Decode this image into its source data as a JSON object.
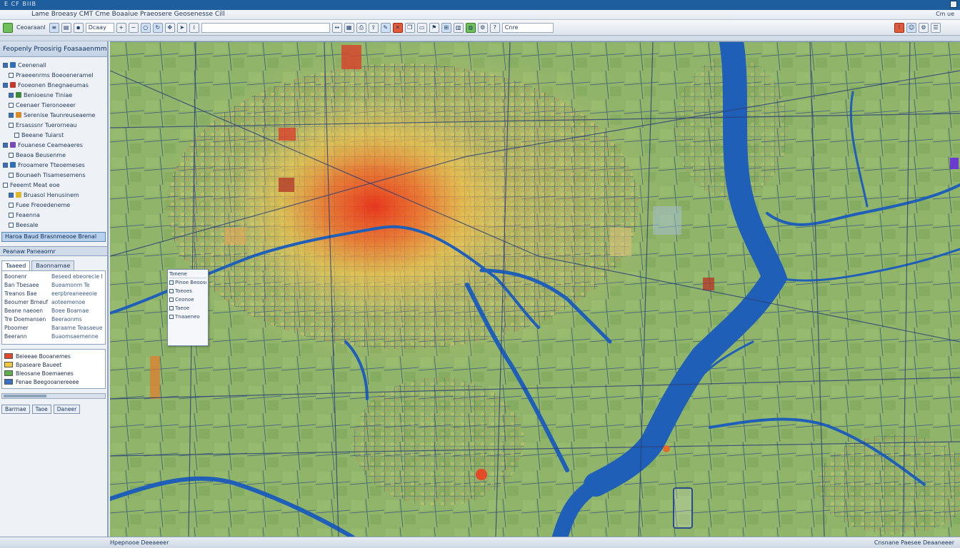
{
  "window": {
    "top_strip_text": "E  CF  BIIB",
    "title": "Lame  Broeasy CMT  Cme  Boaaiue  Praeosere  Geosenesse  Cill",
    "right_title": "Cm  ue"
  },
  "toolbar": {
    "mode_label": "Ceoaraanl",
    "combo_value": "Dcaay",
    "search_value": "",
    "right_label": "Cnre"
  },
  "left_panel": {
    "header": "Feopenly Proosirig Foasaaenmmns",
    "tree": [
      {
        "label": "Ceenenall",
        "checked": true,
        "indent": 0,
        "color": "#2f6fb6"
      },
      {
        "label": "Praeeenrms  Boeoeneramel",
        "checked": false,
        "indent": 1,
        "color": ""
      },
      {
        "label": "Fooeonen  Bnegnaeumas",
        "checked": true,
        "indent": 0,
        "color": "#c43a2a"
      },
      {
        "label": "Benioesne Tiniae",
        "checked": true,
        "indent": 1,
        "color": "#3f8a3a"
      },
      {
        "label": "Ceenaer  Tieronoeeer",
        "checked": false,
        "indent": 1,
        "color": ""
      },
      {
        "label": "Serenise  Taunreuseaeme",
        "checked": true,
        "indent": 1,
        "color": "#d98a2b"
      },
      {
        "label": "Ersasssnr  Tuerorneau",
        "checked": false,
        "indent": 1,
        "color": ""
      },
      {
        "label": "Beeane Tuiarst",
        "checked": false,
        "indent": 2,
        "color": ""
      },
      {
        "label": "Fouanese  Ceameaeres",
        "checked": true,
        "indent": 0,
        "color": "#7c4ab8"
      },
      {
        "label": "Beaoa  Beusenme",
        "checked": false,
        "indent": 1,
        "color": ""
      },
      {
        "label": "Frooamere  Tteoemeses",
        "checked": true,
        "indent": 0,
        "color": "#2f6fb6"
      },
      {
        "label": "Bounaeh  Tisamesemens",
        "checked": false,
        "indent": 1,
        "color": ""
      },
      {
        "label": "Feeemt  Meat  eoe",
        "checked": false,
        "indent": 0,
        "color": ""
      },
      {
        "label": "Bruasol  Henusinem",
        "checked": true,
        "indent": 1,
        "color": "#e0b830"
      },
      {
        "label": "Fuee  Freoedeneme",
        "checked": false,
        "indent": 1,
        "color": ""
      },
      {
        "label": "Feaenna",
        "checked": false,
        "indent": 1,
        "color": ""
      },
      {
        "label": "Beesale",
        "checked": false,
        "indent": 1,
        "color": ""
      }
    ],
    "highlight": "Haroa  Baud  Brasnmeooe  Brenal",
    "highlight_sub": "Peanaw  Paneaomr",
    "tabs": [
      "Taaeed",
      "Baonnamae"
    ],
    "props": [
      {
        "k": "Boonenr",
        "v": "Beseed  ebeorecie  IIB"
      },
      {
        "k": "Ban  Tbesaee",
        "v": "Bueamonm  Te"
      },
      {
        "k": "Treanos  Bae",
        "v": "eerpbreaneeeoie"
      },
      {
        "k": "Beoumer  Bmeuf",
        "v": "aoteemenoe"
      },
      {
        "k": "Beane  naeoen",
        "v": "Boee  Boamae"
      },
      {
        "k": "Tre  Doemansen",
        "v": "Beeraonms"
      },
      {
        "k": "Pboomer",
        "v": "Baraame  Teasaeueent"
      },
      {
        "k": "Beerann",
        "v": "Buaomsaemenne"
      }
    ],
    "legend": [
      {
        "label": "Beieeae  Booanemes",
        "color": "#e04a2a"
      },
      {
        "label": "Bpaseare  Baueet",
        "color": "#f0c840"
      },
      {
        "label": "Bleosane  Boemaenes",
        "color": "#5fae4a"
      },
      {
        "label": "Fenae  Beegooanereeee",
        "color": "#3a6fc4"
      }
    ],
    "bottom_buttons": [
      "Barrnae",
      "Taoe",
      "Daneer"
    ]
  },
  "map": {
    "popup_title": "Tonene",
    "popup_items": [
      "Pinoe  Beoosd",
      "Toeoes",
      "Ceonoe",
      "Taeoe",
      "Tnaaeneo"
    ]
  },
  "status": {
    "left": "Hpepnooe  Deeaeeer",
    "right": "Cnsnane  Paesee  Deaaneeer"
  },
  "colors": {
    "accent": "#1f5e9e",
    "water": "#1f5fb8",
    "land": "#8fb46a",
    "hot": "#e03a1f"
  }
}
